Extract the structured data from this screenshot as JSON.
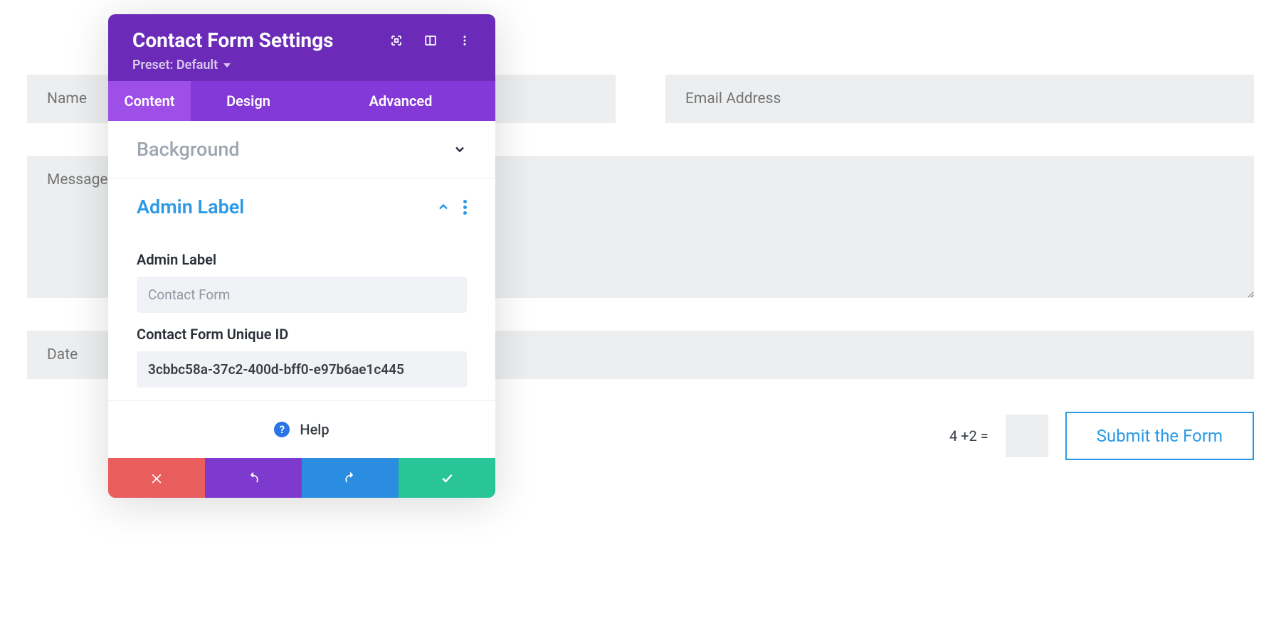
{
  "form": {
    "name_placeholder": "Name",
    "email_placeholder": "Email Address",
    "message_placeholder": "Message",
    "date_placeholder": "Date",
    "captcha_question": "4 +2 =",
    "submit_label": "Submit the Form"
  },
  "panel": {
    "title": "Contact Form Settings",
    "preset_label": "Preset: Default",
    "tabs": {
      "content": "Content",
      "design": "Design",
      "advanced": "Advanced"
    },
    "sections": {
      "background": "Background",
      "admin_label_section": "Admin Label"
    },
    "fields": {
      "admin_label_label": "Admin Label",
      "admin_label_value": "Contact Form",
      "unique_id_label": "Contact Form Unique ID",
      "unique_id_value": "3cbbc58a-37c2-400d-bff0-e97b6ae1c445"
    },
    "help_label": "Help"
  }
}
